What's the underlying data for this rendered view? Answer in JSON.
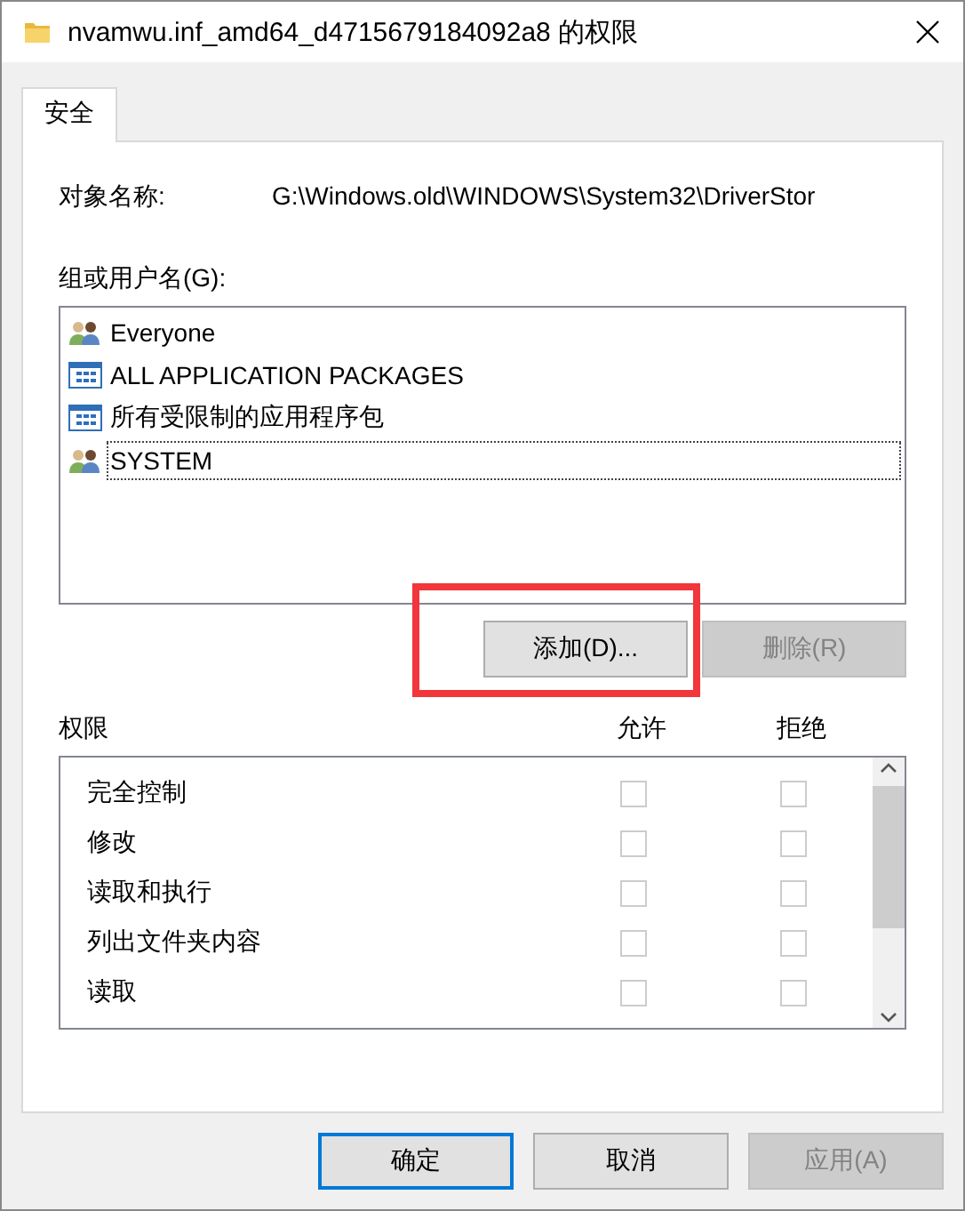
{
  "window": {
    "title": "nvamwu.inf_amd64_d4715679184092a8 的权限"
  },
  "tabs": [
    {
      "label": "安全",
      "selected": true
    }
  ],
  "object_name": {
    "label": "对象名称:",
    "value": "G:\\Windows.old\\WINDOWS\\System32\\DriverStor"
  },
  "groups": {
    "label": "组或用户名(G):",
    "items": [
      {
        "name": "Everyone",
        "kind": "group",
        "focused": false
      },
      {
        "name": "ALL APPLICATION PACKAGES",
        "kind": "package",
        "focused": false
      },
      {
        "name": "所有受限制的应用程序包",
        "kind": "package",
        "focused": false
      },
      {
        "name": "SYSTEM",
        "kind": "group",
        "focused": true
      }
    ]
  },
  "group_buttons": [
    {
      "label": "添加(D)...",
      "disabled": false,
      "highlighted": true
    },
    {
      "label": "删除(R)",
      "disabled": true,
      "highlighted": false
    }
  ],
  "permissions": {
    "label": "权限",
    "allow_label": "允许",
    "deny_label": "拒绝",
    "rows": [
      {
        "name": "完全控制",
        "allow": false,
        "deny": false,
        "disabled": true
      },
      {
        "name": "修改",
        "allow": false,
        "deny": false,
        "disabled": true
      },
      {
        "name": "读取和执行",
        "allow": false,
        "deny": false,
        "disabled": true
      },
      {
        "name": "列出文件夹内容",
        "allow": false,
        "deny": false,
        "disabled": true
      },
      {
        "name": "读取",
        "allow": false,
        "deny": false,
        "disabled": true
      }
    ]
  },
  "dialog_buttons": [
    {
      "label": "确定",
      "default": true,
      "disabled": false
    },
    {
      "label": "取消",
      "default": false,
      "disabled": false
    },
    {
      "label": "应用(A)",
      "default": false,
      "disabled": true
    }
  ]
}
